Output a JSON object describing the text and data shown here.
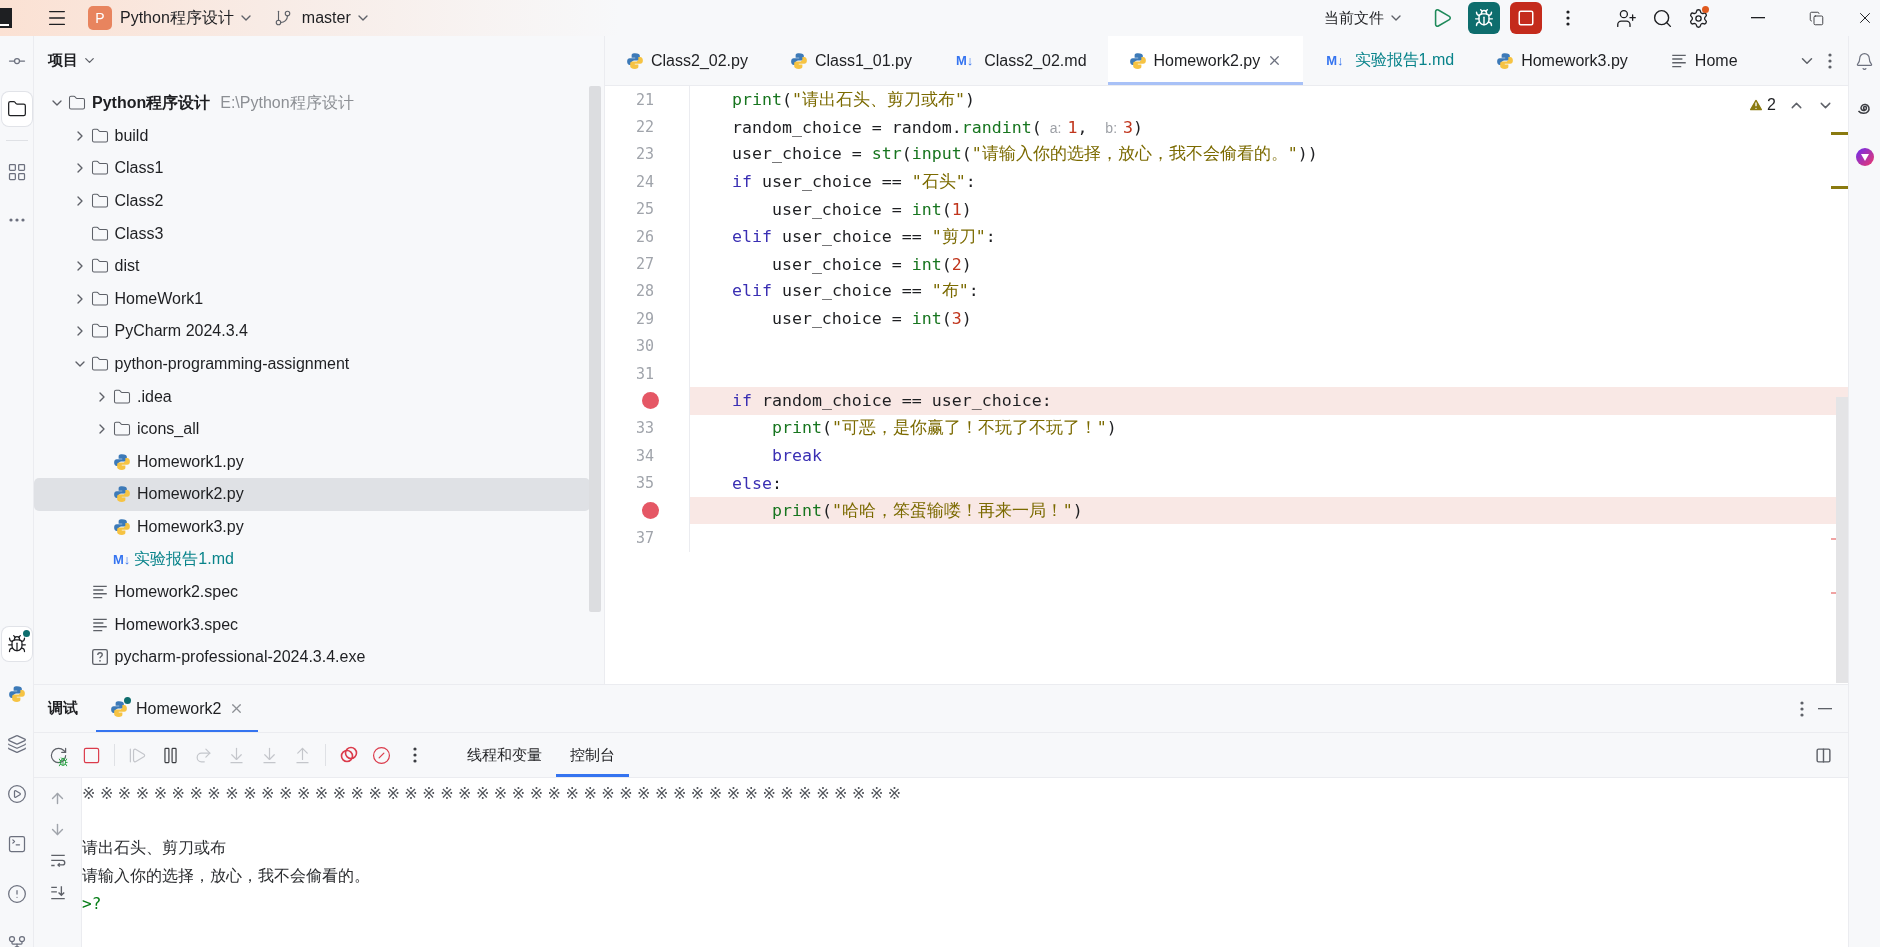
{
  "title_bar": {
    "project_badge": "P",
    "project": "Python程序设计",
    "branch": "master",
    "run_config": "当前文件",
    "settings_notification": true
  },
  "left_toolbar": {
    "top": [
      {
        "kind": "commit",
        "selected": false
      },
      {
        "kind": "project",
        "selected": true
      },
      {
        "kind": "structure",
        "selected": false
      },
      {
        "kind": "more",
        "selected": false
      }
    ],
    "bottom": [
      {
        "kind": "debug",
        "selected": true
      },
      {
        "kind": "python-console",
        "selected": false
      },
      {
        "kind": "services",
        "selected": false
      },
      {
        "kind": "run",
        "selected": false
      },
      {
        "kind": "terminal",
        "selected": false
      },
      {
        "kind": "problems",
        "selected": false
      },
      {
        "kind": "git",
        "selected": false
      }
    ]
  },
  "project_panel": {
    "title": "项目",
    "tree": [
      {
        "name": "Python程序设计",
        "path": "E:\\Python程序设计",
        "kind": "folder",
        "expanded": true,
        "selected": false,
        "color": "#1e1f22",
        "children": [
          {
            "name": "build",
            "kind": "folder",
            "expanded": false,
            "selected": false,
            "color": "#1e1f22"
          },
          {
            "name": "Class1",
            "kind": "folder",
            "expanded": false,
            "selected": false,
            "color": "#1e1f22"
          },
          {
            "name": "Class2",
            "kind": "folder",
            "expanded": false,
            "selected": false,
            "color": "#1e1f22"
          },
          {
            "name": "Class3",
            "kind": "folder",
            "selected": false,
            "color": "#1e1f22"
          },
          {
            "name": "dist",
            "kind": "folder",
            "expanded": false,
            "selected": false,
            "color": "#1e1f22"
          },
          {
            "name": "HomeWork1",
            "kind": "folder",
            "expanded": false,
            "selected": false,
            "color": "#1e1f22"
          },
          {
            "name": "PyCharm 2024.3.4",
            "kind": "folder",
            "expanded": false,
            "selected": false,
            "color": "#1e1f22"
          },
          {
            "name": "python-programming-assignment",
            "kind": "folder",
            "expanded": true,
            "selected": false,
            "color": "#1e1f22",
            "children": [
              {
                "name": ".idea",
                "kind": "folder",
                "expanded": false,
                "selected": false,
                "color": "#1e1f22"
              },
              {
                "name": "icons_all",
                "kind": "folder",
                "expanded": false,
                "selected": false,
                "color": "#1e1f22"
              },
              {
                "name": "Homework1.py",
                "kind": "python",
                "selected": false,
                "color": "#1e1f22"
              },
              {
                "name": "Homework2.py",
                "kind": "python",
                "selected": true,
                "color": "#1e1f22"
              },
              {
                "name": "Homework3.py",
                "kind": "python",
                "selected": false,
                "color": "#1e1f22"
              },
              {
                "name": "实验报告1.md",
                "kind": "markdown",
                "badge": "M↓",
                "selected": false,
                "color": "#08838a"
              }
            ]
          },
          {
            "name": "Homework2.spec",
            "kind": "text",
            "selected": false,
            "color": "#1e1f22"
          },
          {
            "name": "Homework3.spec",
            "kind": "text",
            "selected": false,
            "color": "#1e1f22"
          },
          {
            "name": "pycharm-professional-2024.3.4.exe",
            "kind": "unknown",
            "selected": false,
            "color": "#1e1f22"
          }
        ]
      }
    ]
  },
  "editor": {
    "tabs": [
      {
        "label": "Class2_02.py",
        "kind": "python",
        "selected": false,
        "color": "#1e1f22"
      },
      {
        "label": "Class1_01.py",
        "kind": "python",
        "selected": false,
        "color": "#1e1f22"
      },
      {
        "label": "Class2_02.md",
        "kind": "markdown",
        "badge": "M↓",
        "selected": false,
        "color": "#1e1f22"
      },
      {
        "label": "Homework2.py",
        "kind": "python",
        "selected": true,
        "color": "#1e1f22"
      },
      {
        "label": "实验报告1.md",
        "kind": "markdown",
        "badge": "M↓",
        "selected": false,
        "color": "#08838a"
      },
      {
        "label": "Homework3.py",
        "kind": "python",
        "selected": false,
        "color": "#1e1f22"
      },
      {
        "label": "Home",
        "kind": "text",
        "selected": false,
        "color": "#1e1f22"
      }
    ],
    "warnings": "2",
    "lines": [
      {
        "number": "21",
        "breakpoint": false,
        "tokens": [
          {
            "kind": "builtin",
            "text": "    print"
          },
          {
            "kind": "plain",
            "text": "("
          },
          {
            "kind": "string",
            "text": "\"请出石头、剪刀或布\""
          },
          {
            "kind": "plain",
            "text": ")"
          }
        ]
      },
      {
        "number": "22",
        "breakpoint": false,
        "tokens": [
          {
            "kind": "plain",
            "text": "    random_choice = random."
          },
          {
            "kind": "call",
            "text": "randint"
          },
          {
            "kind": "plain",
            "text": "("
          },
          {
            "kind": "hint",
            "text": "a:"
          },
          {
            "kind": "number",
            "text": "1"
          },
          {
            "kind": "plain",
            "text": ", "
          },
          {
            "kind": "hint",
            "text": "b:"
          },
          {
            "kind": "number",
            "text": "3"
          },
          {
            "kind": "plain",
            "text": ")"
          }
        ]
      },
      {
        "number": "23",
        "breakpoint": false,
        "tokens": [
          {
            "kind": "plain",
            "text": "    user_choice = "
          },
          {
            "kind": "builtin",
            "text": "str"
          },
          {
            "kind": "plain",
            "text": "("
          },
          {
            "kind": "builtin",
            "text": "input"
          },
          {
            "kind": "plain",
            "text": "("
          },
          {
            "kind": "string",
            "text": "\"请输入你的选择，放心，我不会偷看的。\""
          },
          {
            "kind": "plain",
            "text": "))"
          }
        ]
      },
      {
        "number": "24",
        "breakpoint": false,
        "tokens": [
          {
            "kind": "keyword",
            "text": "    if"
          },
          {
            "kind": "plain",
            "text": " user_choice == "
          },
          {
            "kind": "string",
            "text": "\"石头\""
          },
          {
            "kind": "plain",
            "text": ":"
          }
        ]
      },
      {
        "number": "25",
        "breakpoint": false,
        "tokens": [
          {
            "kind": "plain",
            "text": "        user_choice = "
          },
          {
            "kind": "builtin",
            "text": "int"
          },
          {
            "kind": "plain",
            "text": "("
          },
          {
            "kind": "number",
            "text": "1"
          },
          {
            "kind": "plain",
            "text": ")"
          }
        ]
      },
      {
        "number": "26",
        "breakpoint": false,
        "tokens": [
          {
            "kind": "keyword",
            "text": "    elif"
          },
          {
            "kind": "plain",
            "text": " user_choice == "
          },
          {
            "kind": "string",
            "text": "\"剪刀\""
          },
          {
            "kind": "plain",
            "text": ":"
          }
        ]
      },
      {
        "number": "27",
        "breakpoint": false,
        "tokens": [
          {
            "kind": "plain",
            "text": "        user_choice = "
          },
          {
            "kind": "builtin",
            "text": "int"
          },
          {
            "kind": "plain",
            "text": "("
          },
          {
            "kind": "number",
            "text": "2"
          },
          {
            "kind": "plain",
            "text": ")"
          }
        ]
      },
      {
        "number": "28",
        "breakpoint": false,
        "tokens": [
          {
            "kind": "keyword",
            "text": "    elif"
          },
          {
            "kind": "plain",
            "text": " user_choice == "
          },
          {
            "kind": "string",
            "text": "\"布\""
          },
          {
            "kind": "plain",
            "text": ":"
          }
        ]
      },
      {
        "number": "29",
        "breakpoint": false,
        "tokens": [
          {
            "kind": "plain",
            "text": "        user_choice = "
          },
          {
            "kind": "builtin",
            "text": "int"
          },
          {
            "kind": "plain",
            "text": "("
          },
          {
            "kind": "number",
            "text": "3"
          },
          {
            "kind": "plain",
            "text": ")"
          }
        ]
      },
      {
        "number": "30",
        "breakpoint": false
      },
      {
        "number": "31",
        "breakpoint": false
      },
      {
        "breakpoint": true,
        "tokens": [
          {
            "kind": "keyword",
            "text": "    if"
          },
          {
            "kind": "plain",
            "text": " random_choice == user_choice:"
          }
        ]
      },
      {
        "number": "33",
        "breakpoint": false,
        "tokens": [
          {
            "kind": "builtin",
            "text": "        print"
          },
          {
            "kind": "plain",
            "text": "("
          },
          {
            "kind": "string",
            "text": "\"可恶，是你赢了！不玩了不玩了！\""
          },
          {
            "kind": "plain",
            "text": ")"
          }
        ]
      },
      {
        "number": "34",
        "breakpoint": false,
        "tokens": [
          {
            "kind": "keyword",
            "text": "        break"
          }
        ]
      },
      {
        "number": "35",
        "breakpoint": false,
        "tokens": [
          {
            "kind": "keyword",
            "text": "    else"
          },
          {
            "kind": "plain",
            "text": ":"
          }
        ]
      },
      {
        "breakpoint": true,
        "tokens": [
          {
            "kind": "builtin",
            "text": "        print"
          },
          {
            "kind": "plain",
            "text": "("
          },
          {
            "kind": "string",
            "text": "\"哈哈，笨蛋输喽！再来一局！\""
          },
          {
            "kind": "plain",
            "text": ")"
          }
        ]
      },
      {
        "number": "37",
        "breakpoint": false
      }
    ]
  },
  "debug_panel": {
    "title": "调试",
    "session_tab": {
      "label": "Homework2",
      "selected": true
    },
    "toolbar_groups": [
      [
        {
          "kind": "rerun",
          "disabled": false
        },
        {
          "kind": "stop",
          "disabled": false
        }
      ],
      [
        {
          "kind": "resume",
          "disabled": true
        },
        {
          "kind": "pause",
          "disabled": false
        },
        {
          "kind": "step-over",
          "disabled": true
        },
        {
          "kind": "step-into",
          "disabled": true
        },
        {
          "kind": "force-step-into",
          "disabled": true
        },
        {
          "kind": "step-out",
          "disabled": true
        }
      ],
      [
        {
          "kind": "breakpoints",
          "disabled": false
        },
        {
          "kind": "mute-breakpoints",
          "disabled": false
        },
        {
          "kind": "more",
          "disabled": false
        }
      ]
    ],
    "view_tabs": [
      {
        "label": "线程和变量",
        "selected": false
      },
      {
        "label": "控制台",
        "selected": true
      }
    ],
    "console": [
      {
        "kind": "separator",
        "text": "※※※※※※※※※※※※※※※※※※※※※※※※※※※※※※※※※※※※※※※※※※※※※※"
      },
      {
        "kind": "blank"
      },
      {
        "kind": "output",
        "text": "请出石头、剪刀或布"
      },
      {
        "kind": "output",
        "text": "请输入你的选择，放心，我不会偷看的。"
      },
      {
        "kind": "prompt",
        "text": ">?"
      }
    ]
  }
}
